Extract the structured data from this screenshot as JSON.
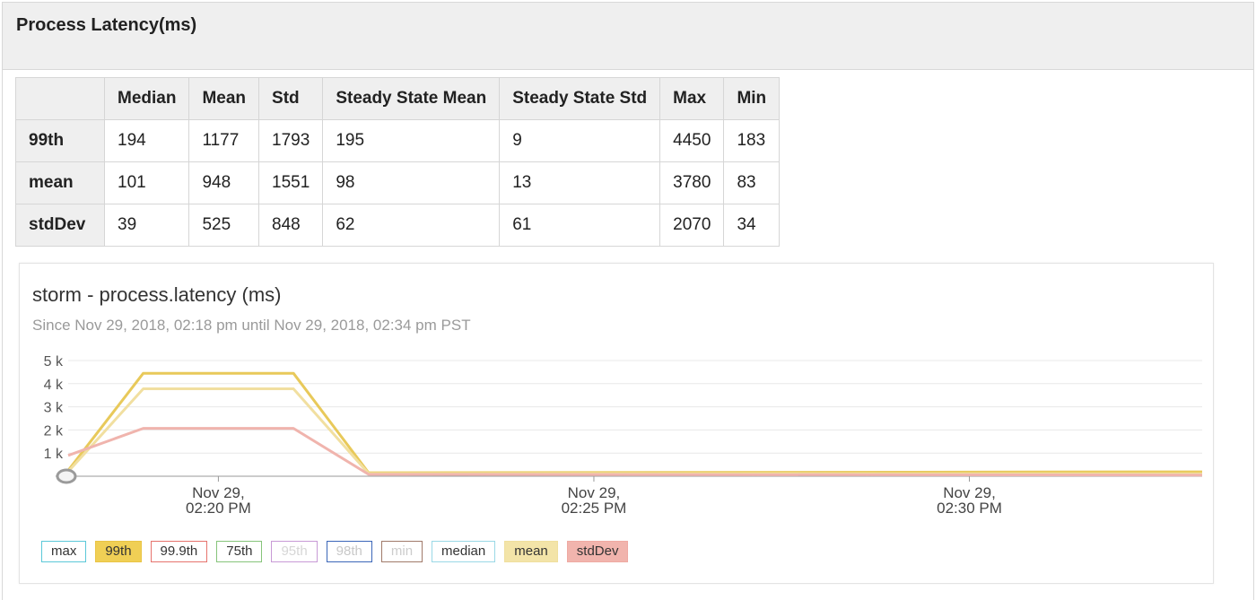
{
  "panel": {
    "title": "Process Latency(ms)"
  },
  "stats_table": {
    "columns": [
      "",
      "Median",
      "Mean",
      "Std",
      "Steady State Mean",
      "Steady State Std",
      "Max",
      "Min"
    ],
    "rows": [
      {
        "label": "99th",
        "values": [
          "194",
          "1177",
          "1793",
          "195",
          "9",
          "4450",
          "183"
        ]
      },
      {
        "label": "mean",
        "values": [
          "101",
          "948",
          "1551",
          "98",
          "13",
          "3780",
          "83"
        ]
      },
      {
        "label": "stdDev",
        "values": [
          "39",
          "525",
          "848",
          "62",
          "61",
          "2070",
          "34"
        ]
      }
    ]
  },
  "chart": {
    "title": "storm - process.latency (ms)",
    "subtitle": "Since Nov 29, 2018, 02:18 pm until Nov 29, 2018, 02:34 pm PST"
  },
  "chart_data": {
    "type": "line",
    "ylim": [
      0,
      5000
    ],
    "y_ticks": [
      "5 k",
      "4 k",
      "3 k",
      "2 k",
      "1 k"
    ],
    "y_tick_values": [
      5000,
      4000,
      3000,
      2000,
      1000
    ],
    "x_ticks": [
      {
        "line1": "Nov 29,",
        "line2": "02:20 PM",
        "minute": 2
      },
      {
        "line1": "Nov 29,",
        "line2": "02:25 PM",
        "minute": 7
      },
      {
        "line1": "Nov 29,",
        "line2": "02:30 PM",
        "minute": 12
      }
    ],
    "xlim": [
      0,
      15.1
    ],
    "grid": true,
    "series": [
      {
        "name": "99th",
        "color": "#e8c95a",
        "points": [
          [
            0,
            250
          ],
          [
            1,
            4450
          ],
          [
            3,
            4450
          ],
          [
            4,
            150
          ],
          [
            15.1,
            190
          ]
        ]
      },
      {
        "name": "mean",
        "color": "#f1dfa0",
        "points": [
          [
            0,
            200
          ],
          [
            1,
            3780
          ],
          [
            3,
            3780
          ],
          [
            4,
            120
          ],
          [
            15.1,
            100
          ]
        ]
      },
      {
        "name": "stdDev",
        "color": "#f0b4ad",
        "points": [
          [
            0,
            900
          ],
          [
            1,
            2070
          ],
          [
            3,
            2070
          ],
          [
            4,
            80
          ],
          [
            15.1,
            50
          ]
        ]
      }
    ]
  },
  "legend": [
    {
      "label": "max",
      "color": "#5bc8d8",
      "fill": "#ffffff",
      "text": "#333333"
    },
    {
      "label": "99th",
      "color": "#e9c445",
      "fill": "#f0cf55",
      "text": "#333333"
    },
    {
      "label": "99.9th",
      "color": "#e6736d",
      "fill": "#ffffff",
      "text": "#333333"
    },
    {
      "label": "75th",
      "color": "#86c47a",
      "fill": "#ffffff",
      "text": "#333333"
    },
    {
      "label": "95th",
      "color": "#c89ad6",
      "fill": "#ffffff",
      "text": "#d6d6d6"
    },
    {
      "label": "98th",
      "color": "#3b66b8",
      "fill": "#ffffff",
      "text": "#c8c8c8"
    },
    {
      "label": "min",
      "color": "#a07a6a",
      "fill": "#ffffff",
      "text": "#cccccc"
    },
    {
      "label": "median",
      "color": "#9ad8e6",
      "fill": "#ffffff",
      "text": "#333333"
    },
    {
      "label": "mean",
      "color": "#f0df9e",
      "fill": "#f3e4a8",
      "text": "#333333"
    },
    {
      "label": "stdDev",
      "color": "#efaaa3",
      "fill": "#f1b4ad",
      "text": "#333333"
    }
  ]
}
